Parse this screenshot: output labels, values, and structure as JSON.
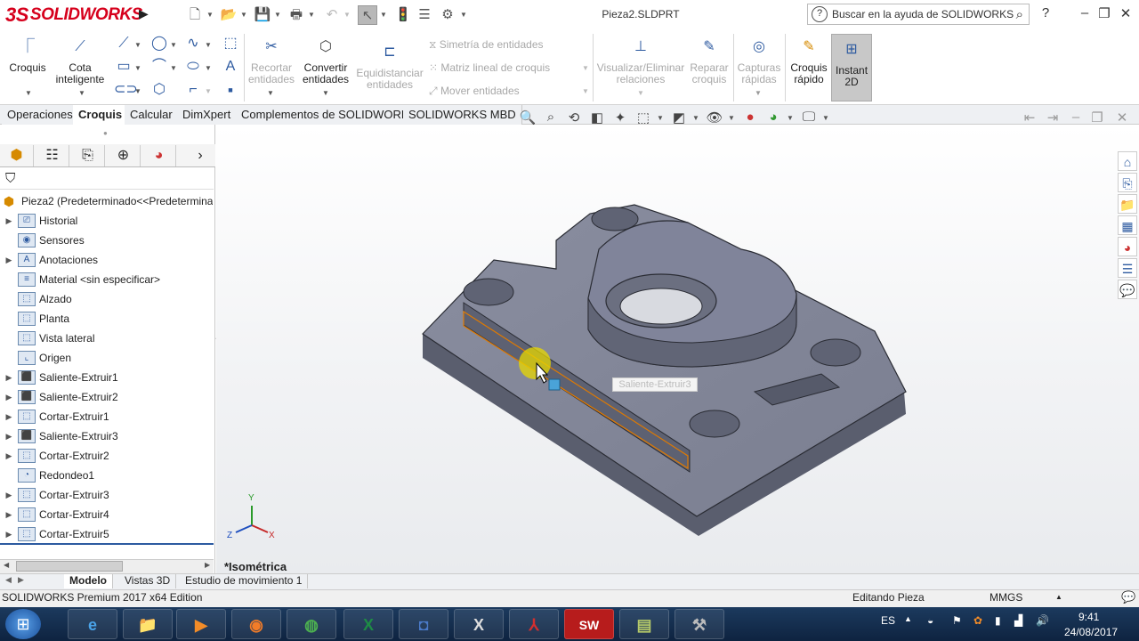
{
  "app": {
    "logo": "SOLIDWORKS",
    "logo_prefix": "3S",
    "document_title": "Pieza2.SLDPRT"
  },
  "search": {
    "placeholder": "Buscar en la ayuda de SOLIDWORKS"
  },
  "ribbon": {
    "croquis": "Croquis",
    "cota": "Cota inteligente",
    "recortar": "Recortar entidades",
    "convertir": "Convertir entidades",
    "equidistanciar": "Equidistanciar entidades",
    "simetria": "Simetría de entidades",
    "matriz": "Matriz lineal de croquis",
    "mover": "Mover entidades",
    "visualizar": "Visualizar/Eliminar relaciones",
    "reparar": "Reparar croquis",
    "capturas": "Capturas rápidas",
    "croquis_rapido": "Croquis rápido",
    "instant": "Instant 2D"
  },
  "command_tabs": [
    "Operaciones",
    "Croquis",
    "Calcular",
    "DimXpert",
    "Complementos de SOLIDWORKS",
    "SOLIDWORKS MBD"
  ],
  "tree": {
    "root": "Pieza2  (Predeterminado<<Predetermina",
    "items": [
      {
        "label": "Historial",
        "icon": "history-icon",
        "expand": true
      },
      {
        "label": "Sensores",
        "icon": "sensor-icon",
        "expand": false
      },
      {
        "label": "Anotaciones",
        "icon": "annotation-icon",
        "expand": true
      },
      {
        "label": "Material <sin especificar>",
        "icon": "material-icon",
        "expand": false
      },
      {
        "label": "Alzado",
        "icon": "plane-icon",
        "expand": false
      },
      {
        "label": "Planta",
        "icon": "plane-icon",
        "expand": false
      },
      {
        "label": "Vista lateral",
        "icon": "plane-icon",
        "expand": false
      },
      {
        "label": "Origen",
        "icon": "origin-icon",
        "expand": false
      },
      {
        "label": "Saliente-Extruir1",
        "icon": "extrude-icon",
        "expand": true
      },
      {
        "label": "Saliente-Extruir2",
        "icon": "extrude-icon",
        "expand": true
      },
      {
        "label": "Cortar-Extruir1",
        "icon": "cut-icon",
        "expand": true
      },
      {
        "label": "Saliente-Extruir3",
        "icon": "extrude-icon",
        "expand": true
      },
      {
        "label": "Cortar-Extruir2",
        "icon": "cut-icon",
        "expand": true
      },
      {
        "label": "Redondeo1",
        "icon": "fillet-icon",
        "expand": false
      },
      {
        "label": "Cortar-Extruir3",
        "icon": "cut-icon",
        "expand": true
      },
      {
        "label": "Cortar-Extruir4",
        "icon": "cut-icon",
        "expand": true
      },
      {
        "label": "Cortar-Extruir5",
        "icon": "cut-icon",
        "expand": true
      }
    ]
  },
  "viewport": {
    "view_name": "*Isométrica",
    "tooltip": "Saliente-Extruir3",
    "triad_x": "X",
    "triad_y": "Y",
    "triad_z": "Z"
  },
  "bottom_tabs": [
    "Modelo",
    "Vistas 3D",
    "Estudio de movimiento 1"
  ],
  "status": {
    "edition": "SOLIDWORKS Premium 2017 x64 Edition",
    "mode": "Editando Pieza",
    "units": "MMGS"
  },
  "taskbar": {
    "lang": "ES",
    "time": "9:41",
    "date": "24/08/2017"
  },
  "colors": {
    "accent": "#d6001c",
    "part": "#7c8090",
    "edge_highlight": "#e07a00"
  }
}
